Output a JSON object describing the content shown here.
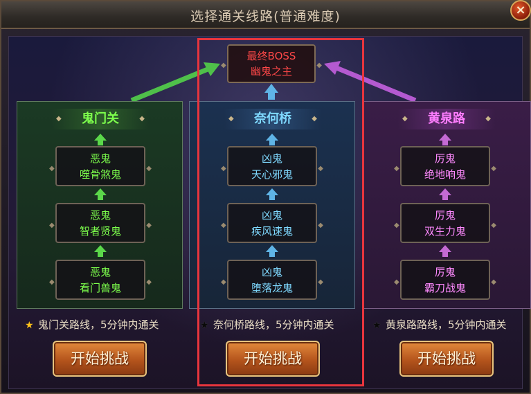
{
  "title": "选择通关线路(普通难度)",
  "close_label": "×",
  "boss": {
    "line1": "最终BOSS",
    "line2": "幽鬼之主"
  },
  "lanes": [
    {
      "name": "鬼门关",
      "nodes": [
        {
          "line1": "恶鬼",
          "line2": "噬骨煞鬼"
        },
        {
          "line1": "恶鬼",
          "line2": "智者贤鬼"
        },
        {
          "line1": "恶鬼",
          "line2": "看门兽鬼"
        }
      ],
      "desc": "鬼门关路线，5分钟内通关",
      "star": "★",
      "button": "开始挑战"
    },
    {
      "name": "奈何桥",
      "nodes": [
        {
          "line1": "凶鬼",
          "line2": "天心邪鬼"
        },
        {
          "line1": "凶鬼",
          "line2": "疾风速鬼"
        },
        {
          "line1": "凶鬼",
          "line2": "堕落龙鬼"
        }
      ],
      "desc": "奈何桥路线，5分钟内通关",
      "star": "★",
      "button": "开始挑战"
    },
    {
      "name": "黄泉路",
      "nodes": [
        {
          "line1": "厉鬼",
          "line2": "绝地响鬼"
        },
        {
          "line1": "厉鬼",
          "line2": "双生力鬼"
        },
        {
          "line1": "厉鬼",
          "line2": "霸刀战鬼"
        }
      ],
      "desc": "黄泉路路线，5分钟内通关",
      "star": "★",
      "button": "开始挑战"
    }
  ],
  "colors": {
    "green": "#7dff4c",
    "blue": "#7fd9ff",
    "purple": "#ff7dff",
    "boss": "#ff4848",
    "highlight": "#e8353d"
  },
  "icons": {
    "close": "close-icon",
    "star": "star-icon",
    "arrow": "arrow-up-icon"
  }
}
